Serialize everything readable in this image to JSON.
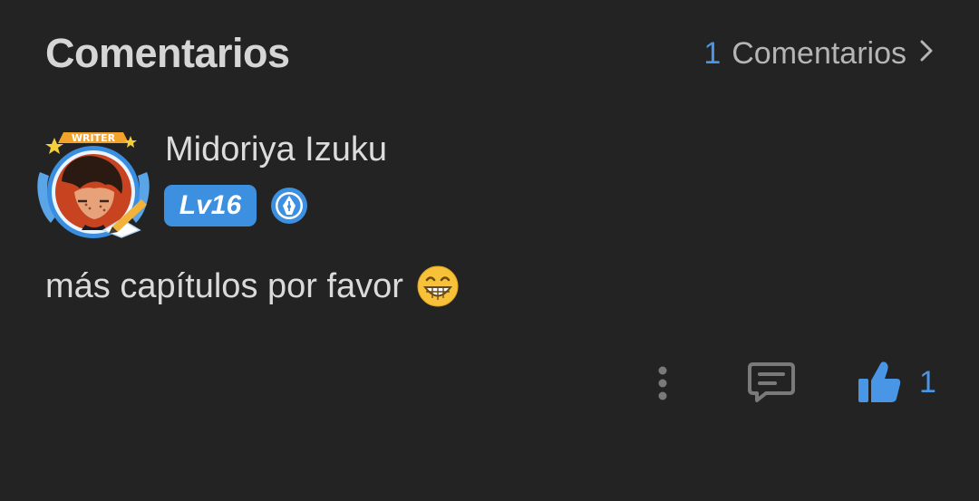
{
  "header": {
    "title": "Comentarios",
    "count": "1",
    "count_label": "Comentarios",
    "chevron_icon": "chevron-right-icon"
  },
  "comment": {
    "user_name": "Midoriya Izuku",
    "avatar_frame_label": "WRITER",
    "level": "Lv16",
    "badge_icon": "pen-nib-badge-icon",
    "text": "más capítulos por favor",
    "emoji_icon": "grinning-face-icon",
    "actions": {
      "more_icon": "more-vertical-icon",
      "reply_icon": "comment-reply-icon",
      "like_icon": "thumbs-up-icon",
      "like_count": "1"
    }
  },
  "colors": {
    "background": "#232323",
    "accent": "#4a96e6",
    "level_badge": "#3d8fe0",
    "text_primary": "#dadada",
    "text_secondary": "#b5b5b5"
  }
}
